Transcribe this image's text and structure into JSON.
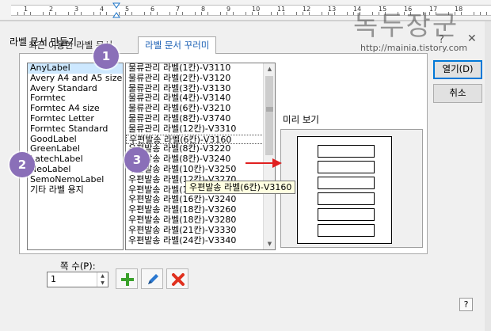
{
  "ruler": {
    "numbers": [
      "1",
      "2",
      "3",
      "4",
      "5",
      "6",
      "7",
      "8",
      "9",
      "10",
      "11",
      "12",
      "13",
      "14",
      "15",
      "16",
      "17",
      "18"
    ]
  },
  "watermark": {
    "korean": "녹두장군",
    "url": "http://mainia.tistory.com"
  },
  "dialog": {
    "title": "라벨 문서 만들기",
    "help_icon": "?",
    "close_icon": "✕",
    "tabs": [
      {
        "label": "최근 이용한 라벨 문서"
      },
      {
        "label": "라벨 문서 꾸러미"
      }
    ],
    "left_list": [
      "AnyLabel",
      "Avery A4 and A5 size",
      "Avery Standard",
      "Formtec",
      "Formtec A4 size",
      "Formtec Letter",
      "Formtec Standard",
      "GoodLabel",
      "GreenLabel",
      "LatechLabel",
      "NeoLabel",
      "SemoNemoLabel",
      "기타 라벨 용지"
    ],
    "middle_list": [
      "물류관리 라벨(1칸)-V3110",
      "물류관리 라벨(2칸)-V3120",
      "물류관리 라벨(3칸)-V3130",
      "물류관리 라벨(4칸)-V3140",
      "물류관리 라벨(6칸)-V3210",
      "물류관리 라벨(8칸)-V3740",
      "물류관리 라벨(12칸)-V3310",
      "우편발송 라벨(6칸)-V3160",
      "우편발송 라벨(8칸)-V3220",
      "우편발송 라벨(8칸)-V3240",
      "우편발송 라벨(10칸)-V3250",
      "우편발송 라벨(12칸)-V3270",
      "우편발송 라벨(14칸)-V3230",
      "우편발송 라벨(16칸)-V3240",
      "우편발송 라벨(18칸)-V3260",
      "우편발송 라벨(18칸)-V3280",
      "우편발송 라벨(21칸)-V3330",
      "우편발송 라벨(24칸)-V3340"
    ],
    "tooltip": "우편발송 라벨(6칸)-V3160",
    "preview_label": "미리 보기",
    "preview_cells": 6,
    "open_button": "열기(D)",
    "cancel_button": "취소",
    "count_label": "쪽 수(P):",
    "count_value": "1",
    "help_button": "?",
    "badges": [
      "1",
      "2",
      "3"
    ]
  },
  "colors": {
    "badge": "#8a6fb8",
    "arrow": "#e02020",
    "selection": "#cde8ff",
    "accent": "#0078d7"
  }
}
